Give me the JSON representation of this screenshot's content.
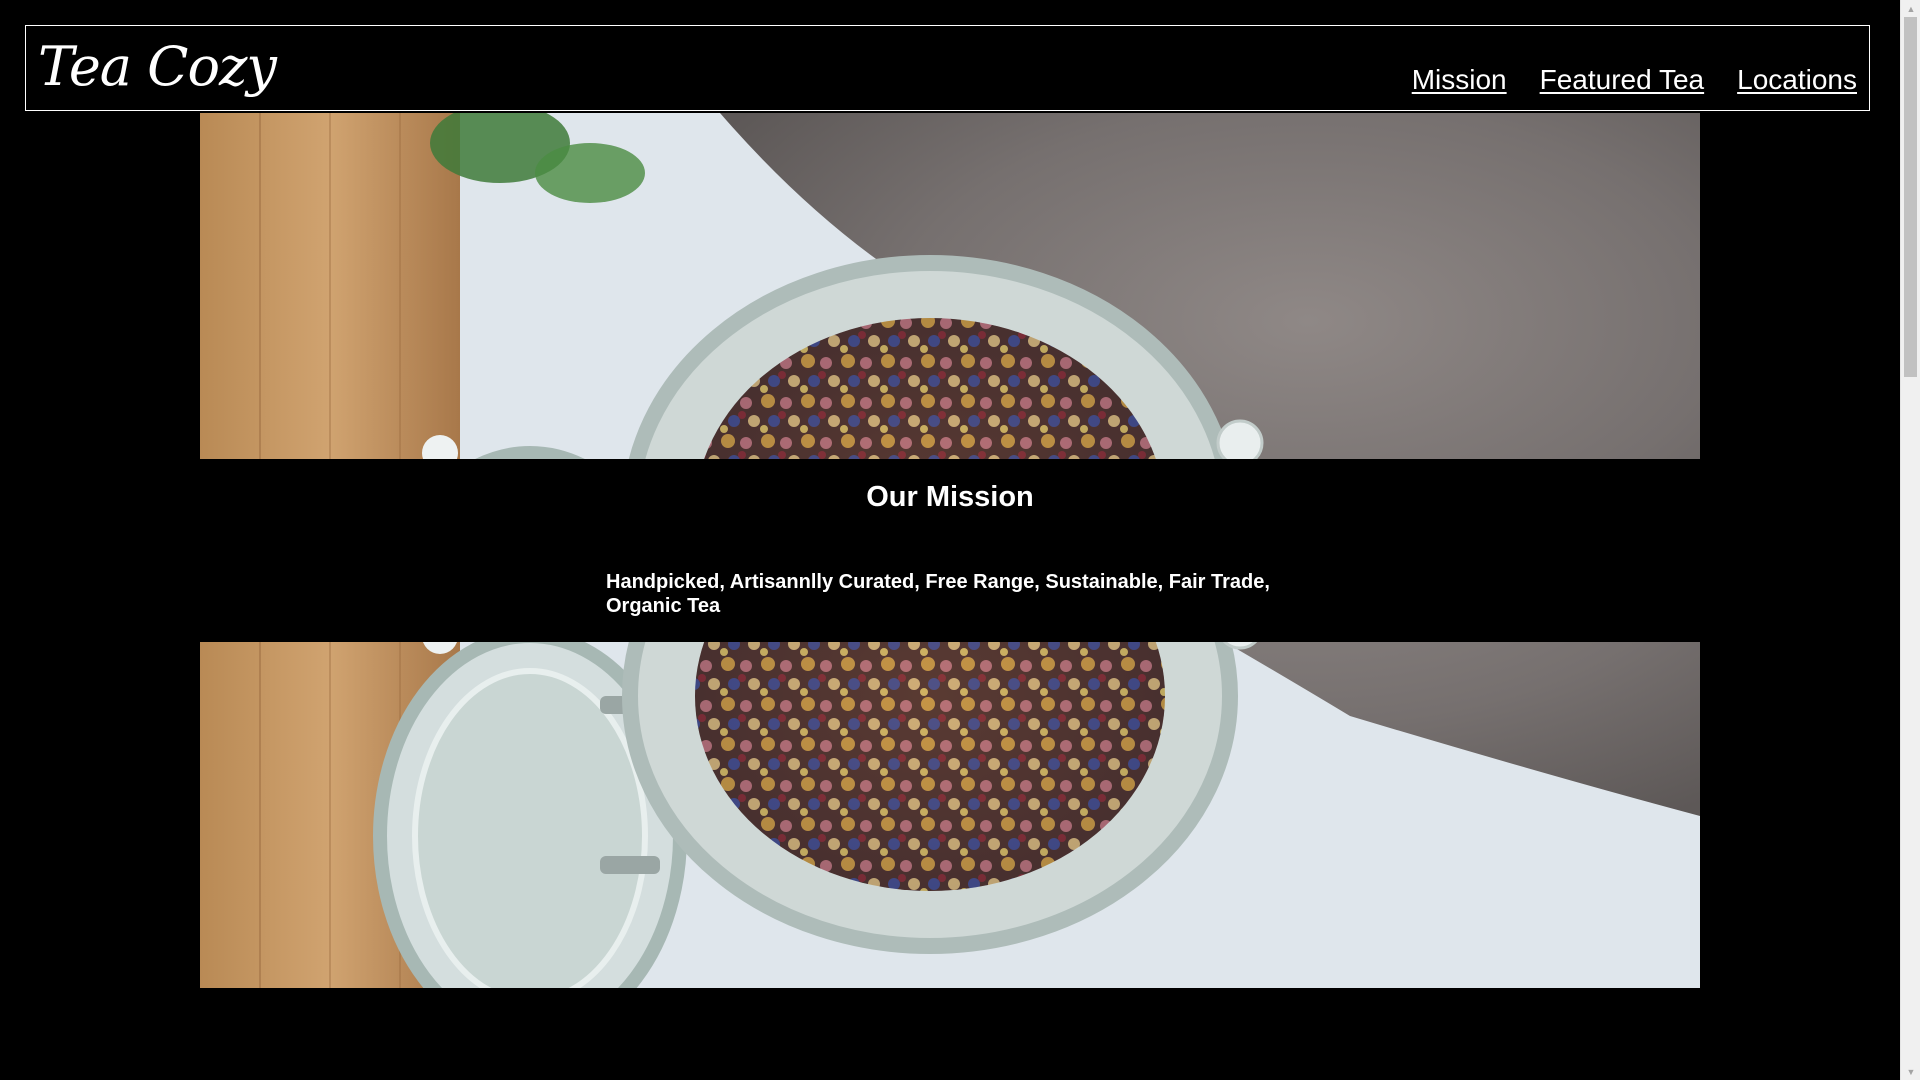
{
  "header": {
    "logo_text": "Tea Cozy",
    "nav": [
      {
        "label": "Mission"
      },
      {
        "label": "Featured Tea"
      },
      {
        "label": "Locations"
      }
    ]
  },
  "mission": {
    "title": "Our Mission",
    "text": "Handpicked, Artisannlly Curated, Free Range, Sustainable, Fair Trade, Organic Tea"
  },
  "colors": {
    "background": "#000000",
    "text": "#ffffff",
    "header_border": "#ffffff"
  },
  "icons": {
    "scroll_up": "scroll-up-arrow-icon",
    "scroll_down": "scroll-down-arrow-icon"
  }
}
